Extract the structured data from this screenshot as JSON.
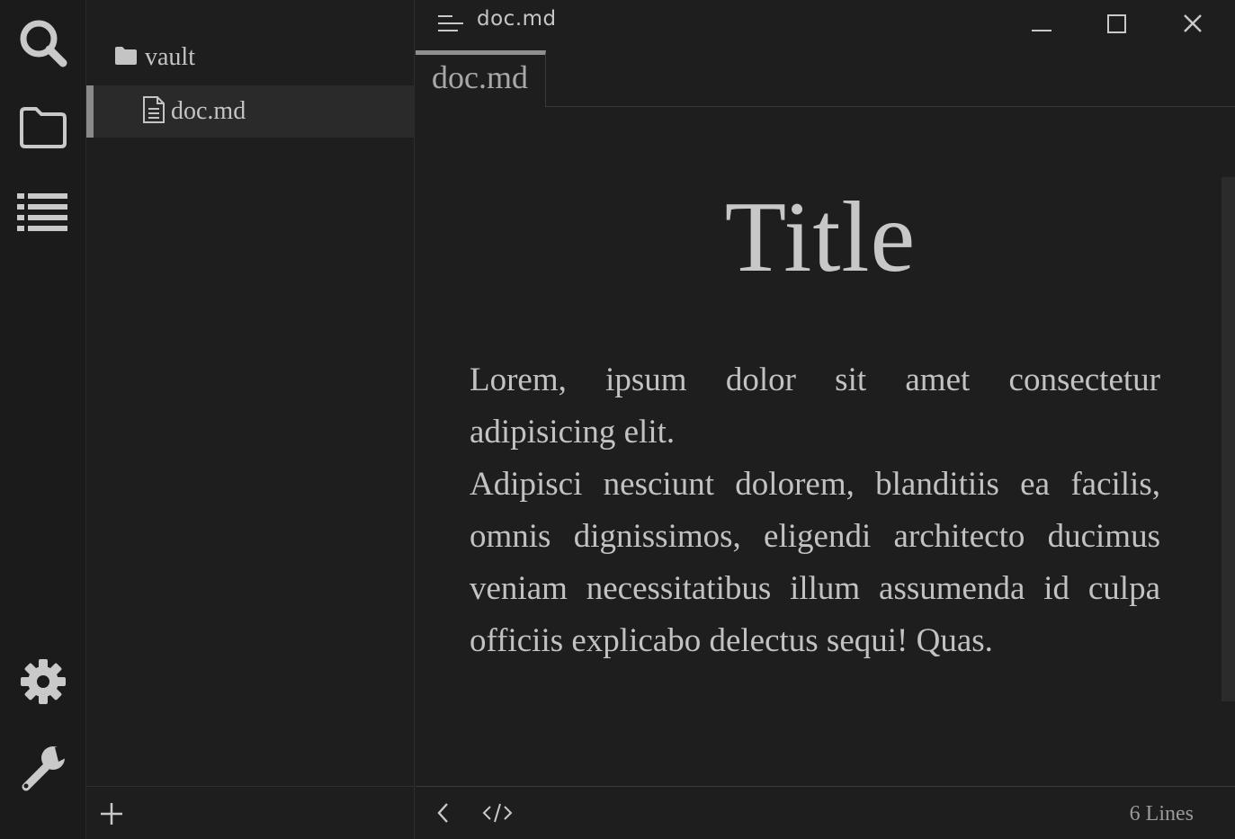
{
  "window": {
    "title": "doc.md",
    "controls": [
      "minimize",
      "maximize",
      "close"
    ]
  },
  "activity_bar": {
    "top_items": [
      {
        "icon": "search-icon"
      },
      {
        "icon": "folder-icon"
      },
      {
        "icon": "list-icon"
      }
    ],
    "bottom_items": [
      {
        "icon": "gear-icon"
      },
      {
        "icon": "wrench-icon"
      }
    ]
  },
  "explorer": {
    "folder": {
      "label": "vault",
      "icon": "folder-filled-icon"
    },
    "files": [
      {
        "label": "doc.md",
        "icon": "document-icon",
        "selected": true
      }
    ],
    "footer": {
      "add_icon": "plus-icon"
    }
  },
  "tabs": [
    {
      "label": "doc.md",
      "active": true
    }
  ],
  "document": {
    "title": "Title",
    "paragraphs": [
      "Lorem, ipsum dolor sit amet consectetur adipisicing elit.",
      "Adipisci nesciunt dolorem, blanditiis ea facilis, omnis dignissimos, eligendi architecto ducimus veniam necessitatibus illum assumenda id culpa officiis explicabo delectus sequi! Quas."
    ]
  },
  "statusbar": {
    "back_icon": "chevron-left-icon",
    "code_icon": "code-icon",
    "lines": "6 Lines"
  },
  "colors": {
    "background": "#1e1e1e",
    "activity_bar": "#1b1b1b",
    "selection": "#2a2a2a",
    "accent": "#8f8f8f",
    "text": "#c2c2c2"
  }
}
